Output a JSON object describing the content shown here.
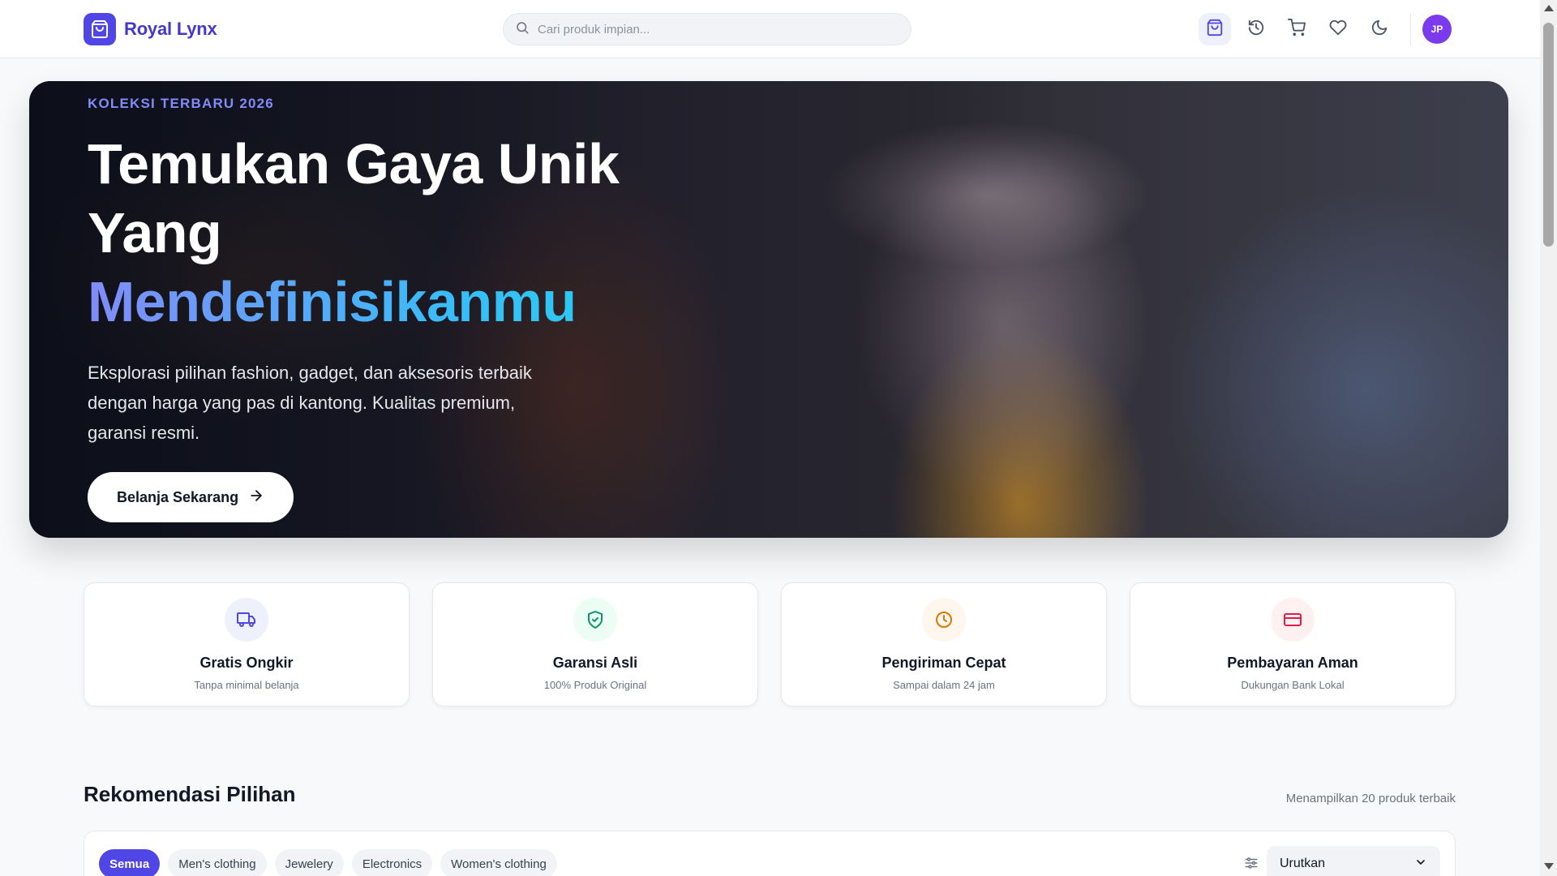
{
  "brand": {
    "name": "Royal Lynx",
    "logo_icon": "shopping-bag-icon",
    "accent_color": "#4f46e5"
  },
  "search": {
    "placeholder": "Cari produk impian..."
  },
  "header_icons": [
    "shopping-bag-icon",
    "history-icon",
    "cart-icon",
    "heart-icon",
    "moon-icon"
  ],
  "user": {
    "initials": "JP"
  },
  "hero": {
    "eyebrow": "KOLEKSI TERBARU 2026",
    "title_line1": "Temukan Gaya Unik",
    "title_line2": "Yang",
    "title_accent": "Mendefinisikanmu",
    "description": "Eksplorasi pilihan fashion, gadget, dan aksesoris terbaik dengan harga yang pas di kantong. Kualitas premium, garansi resmi.",
    "cta_label": "Belanja Sekarang"
  },
  "features": [
    {
      "title": "Gratis Ongkir",
      "subtitle": "Tanpa minimal belanja",
      "icon": "truck-icon",
      "color": "#4f46e5"
    },
    {
      "title": "Garansi Asli",
      "subtitle": "100% Produk Original",
      "icon": "shield-check-icon",
      "color": "#059669"
    },
    {
      "title": "Pengiriman Cepat",
      "subtitle": "Sampai dalam 24 jam",
      "icon": "clock-icon",
      "color": "#d97706"
    },
    {
      "title": "Pembayaran Aman",
      "subtitle": "Dukungan Bank Lokal",
      "icon": "credit-card-icon",
      "color": "#e11d48"
    }
  ],
  "recommendations": {
    "title": "Rekomendasi Pilihan",
    "count_text": "Menampilkan 20 produk terbaik",
    "categories": [
      "Semua",
      "Men's clothing",
      "Jewelery",
      "Electronics",
      "Women's clothing"
    ],
    "active_category": "Semua",
    "sort_label": "Urutkan"
  }
}
